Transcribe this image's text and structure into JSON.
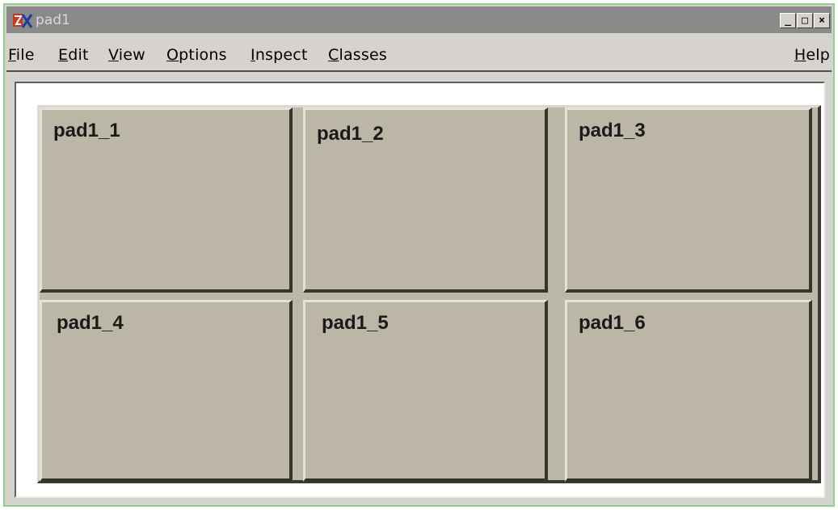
{
  "window": {
    "title": "pad1",
    "controls": {
      "minimize": "_",
      "maximize": "□",
      "close": "×"
    }
  },
  "menubar": {
    "items": [
      {
        "underline": "F",
        "rest": "ile"
      },
      {
        "underline": "E",
        "rest": "dit"
      },
      {
        "underline": "V",
        "rest": "iew"
      },
      {
        "underline": "O",
        "rest": "ptions"
      },
      {
        "underline": "I",
        "rest": "nspect"
      },
      {
        "underline": "C",
        "rest": "lasses"
      }
    ],
    "help": {
      "underline": "H",
      "rest": "elp"
    }
  },
  "pads": [
    {
      "label": "pad1_1"
    },
    {
      "label": "pad1_2"
    },
    {
      "label": "pad1_3"
    },
    {
      "label": "pad1_4"
    },
    {
      "label": "pad1_5"
    },
    {
      "label": "pad1_6"
    }
  ],
  "colors": {
    "titlebar": "#8a8a8a",
    "window_bg": "#d6d3ce",
    "pad_fill": "#bcb6a6",
    "canvas_bg": "#ffffff"
  }
}
